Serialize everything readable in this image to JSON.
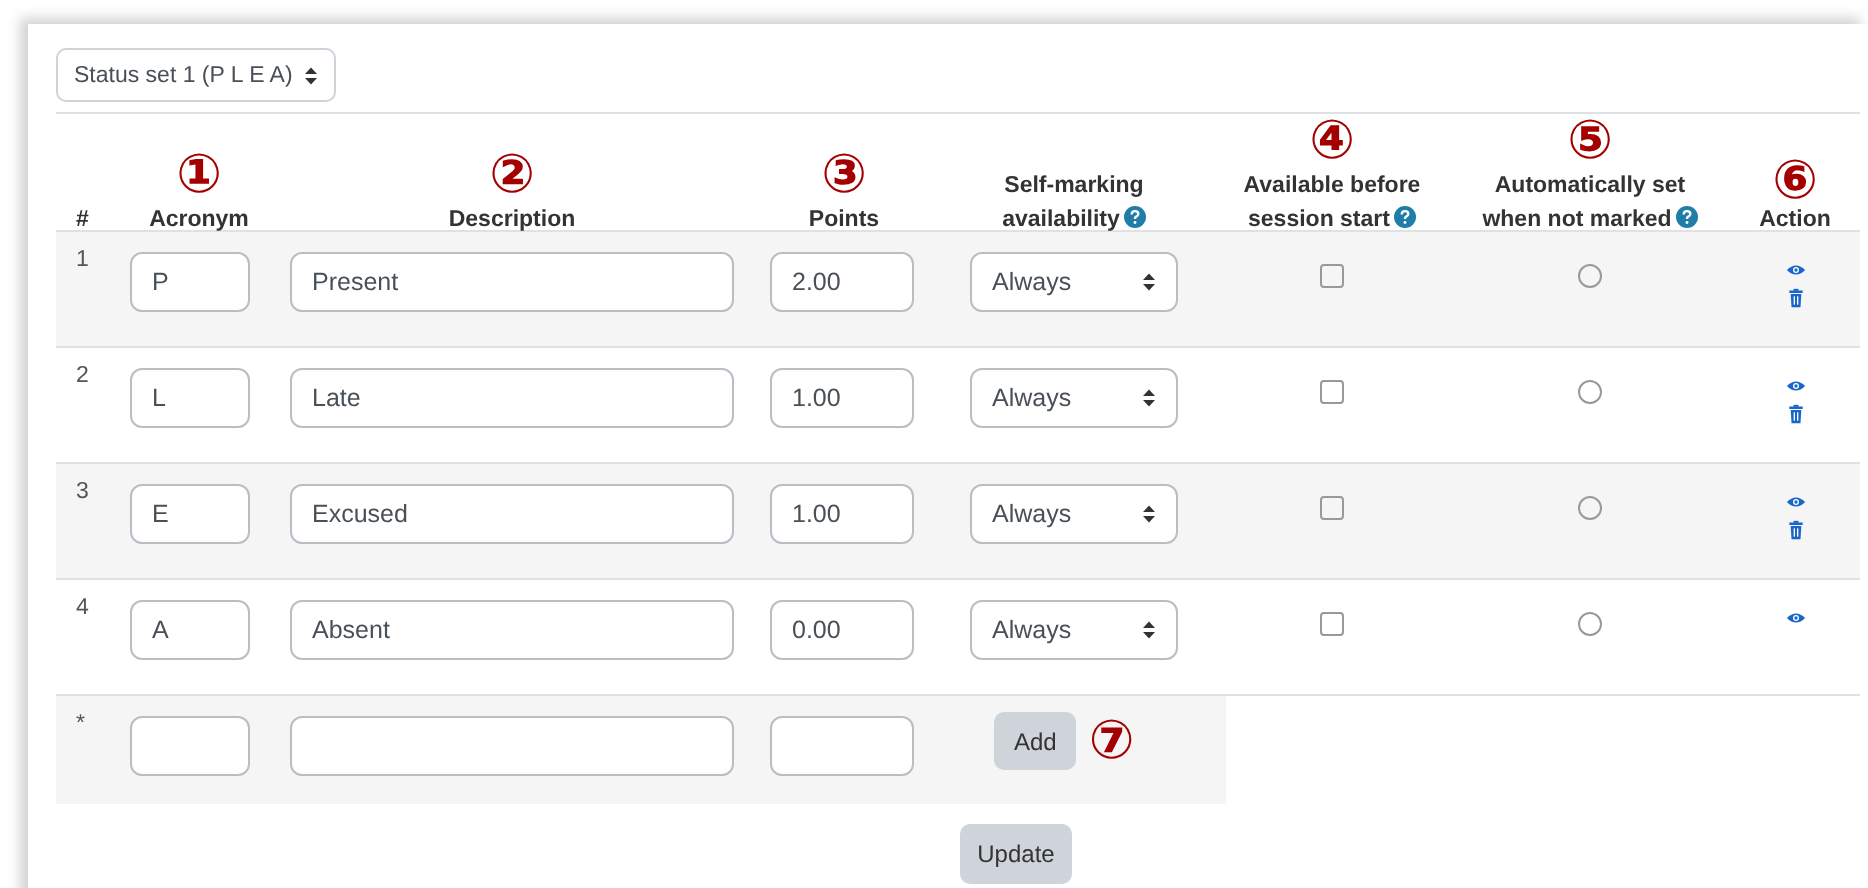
{
  "status_set": {
    "value": "Status set 1 (P L E A)"
  },
  "columns": [
    {
      "label": "#",
      "help": false
    },
    {
      "label": "Acronym",
      "annotation": "①",
      "help": false
    },
    {
      "label": "Description",
      "annotation": "②",
      "help": false
    },
    {
      "label": "Points",
      "annotation": "③",
      "help": false
    },
    {
      "label": "Self-marking availability",
      "help": true
    },
    {
      "label": "Available before session start",
      "annotation": "④",
      "help": true
    },
    {
      "label": "Automatically set when not marked",
      "annotation": "⑤",
      "help": true
    },
    {
      "label": "Action",
      "annotation": "⑥",
      "help": false
    }
  ],
  "rows": [
    {
      "number": "1",
      "acronym": "P",
      "description": "Present",
      "points": "2.00",
      "availability": "Always",
      "available_before": false,
      "auto_set": false
    },
    {
      "number": "2",
      "acronym": "L",
      "description": "Late",
      "points": "1.00",
      "availability": "Always",
      "available_before": false,
      "auto_set": false
    },
    {
      "number": "3",
      "acronym": "E",
      "description": "Excused",
      "points": "1.00",
      "availability": "Always",
      "available_before": false,
      "auto_set": false
    },
    {
      "number": "4",
      "acronym": "A",
      "description": "Absent",
      "points": "0.00",
      "availability": "Always",
      "available_before": false,
      "auto_set": false
    }
  ],
  "new_row": {
    "marker": "*",
    "add_button": "Add",
    "annotation": "⑦"
  },
  "update_button": "Update"
}
